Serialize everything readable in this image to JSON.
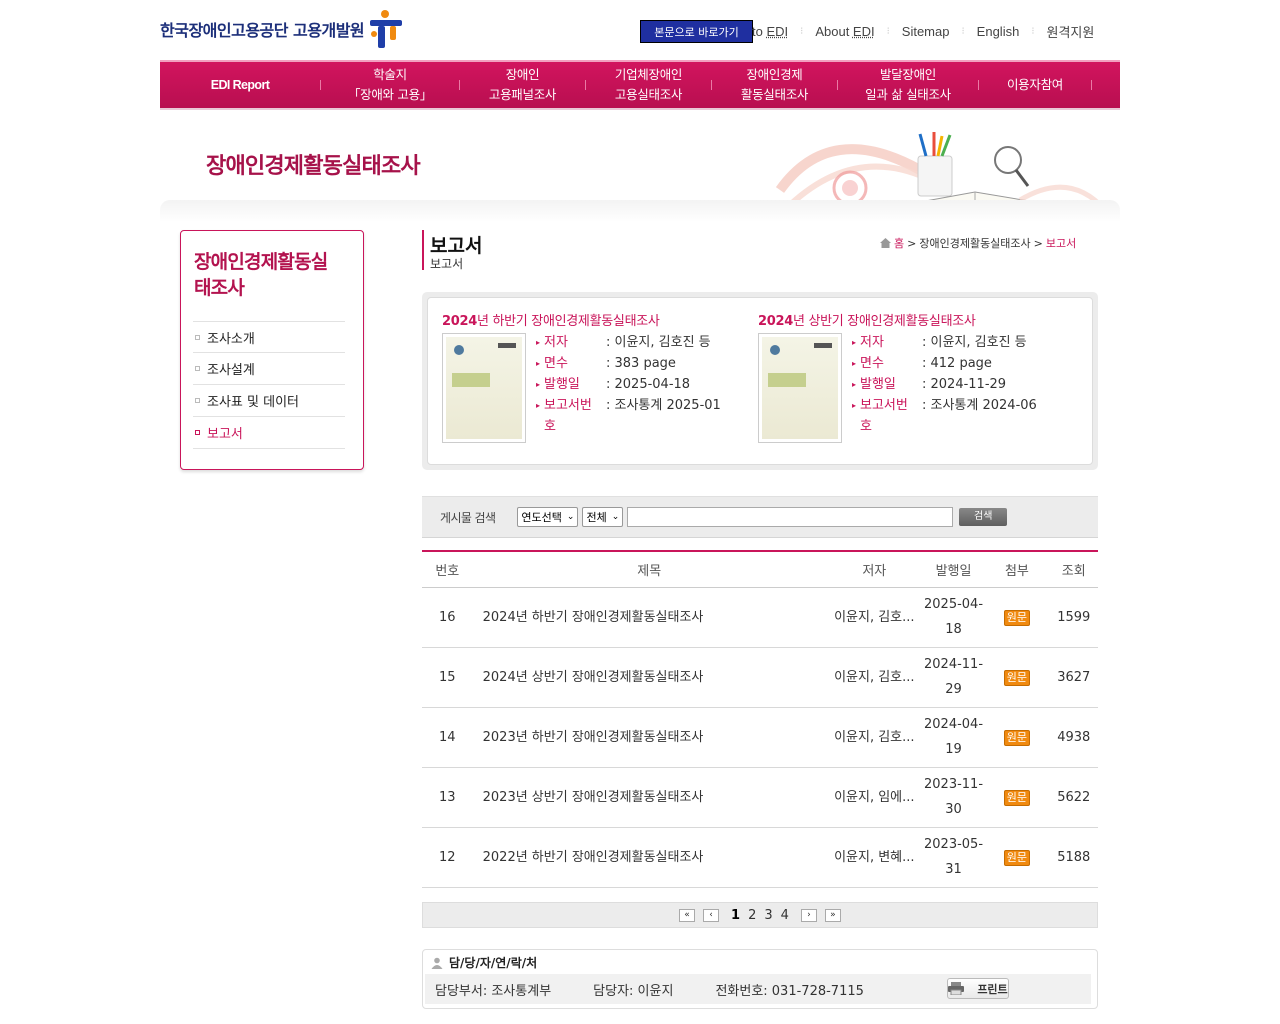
{
  "header": {
    "logo_text": "한국장애인고용공단 고용개발원",
    "skip_link": "본문으로 바로가기",
    "top_links": [
      {
        "text": "to ",
        "abbr": "EDI"
      },
      {
        "text": "About ",
        "abbr": "EDI"
      },
      {
        "text": "Sitemap",
        "abbr": ""
      },
      {
        "text": "English",
        "abbr": ""
      },
      {
        "text": "원격지원",
        "abbr": ""
      }
    ]
  },
  "gnb": {
    "items": [
      {
        "line1": "EDI Report",
        "line2": ""
      },
      {
        "line1": "학술지",
        "line2": "「장애와 고용」"
      },
      {
        "line1": "장애인",
        "line2": "고용패널조사"
      },
      {
        "line1": "기업체장애인",
        "line2": "고용실태조사"
      },
      {
        "line1": "장애인경제",
        "line2": "활동실태조사"
      },
      {
        "line1": "발달장애인",
        "line2": "일과 삶 실태조사"
      },
      {
        "line1": "이용자참여",
        "line2": ""
      }
    ]
  },
  "visual": {
    "title": "장애인경제활동실태조사"
  },
  "lnb": {
    "title": "장애인경제활동실태조사",
    "items": [
      {
        "label": "조사소개"
      },
      {
        "label": "조사설계"
      },
      {
        "label": "조사표 및 데이터"
      },
      {
        "label": "보고서"
      }
    ],
    "active": "보고서"
  },
  "content": {
    "title": "보고서",
    "subtitle": "보고서",
    "breadcrumb": {
      "home": "홈",
      "sep": ">",
      "level1": "장애인경제활동실태조사",
      "current": "보고서"
    }
  },
  "featured": [
    {
      "year": "2024",
      "title_rest": "년 하반기 장애인경제활동실태조사",
      "fields": [
        {
          "label": "저자",
          "value": ": 이윤지, 김호진 등"
        },
        {
          "label": "면수",
          "value": ": 383 page"
        },
        {
          "label": "발행일",
          "value": ": 2025-04-18"
        },
        {
          "label": "보고서번호",
          "value": ": 조사통계 2025-01"
        }
      ]
    },
    {
      "year": "2024",
      "title_rest": "년 상반기 장애인경제활동실태조사",
      "fields": [
        {
          "label": "저자",
          "value": ": 이윤지, 김호진 등"
        },
        {
          "label": "면수",
          "value": ": 412 page"
        },
        {
          "label": "발행일",
          "value": ": 2024-11-29"
        },
        {
          "label": "보고서번호",
          "value": ": 조사통계 2024-06"
        }
      ]
    }
  ],
  "search": {
    "label": "게시물 검색",
    "year_select": "연도선택",
    "field_select": "전체",
    "input_value": "",
    "button": "검색"
  },
  "table": {
    "headers": [
      "번호",
      "제목",
      "저자",
      "발행일",
      "첨부",
      "조회"
    ],
    "rows": [
      {
        "no": "16",
        "title": "2024년 하반기 장애인경제활동실태조사",
        "author": "이윤지, 김호...",
        "date1": "2025-04-",
        "date2": "18",
        "attach": "원문",
        "views": "1599"
      },
      {
        "no": "15",
        "title": "2024년 상반기 장애인경제활동실태조사",
        "author": "이윤지, 김호...",
        "date1": "2024-11-",
        "date2": "29",
        "attach": "원문",
        "views": "3627"
      },
      {
        "no": "14",
        "title": "2023년 하반기 장애인경제활동실태조사",
        "author": "이윤지, 김호...",
        "date1": "2024-04-",
        "date2": "19",
        "attach": "원문",
        "views": "4938"
      },
      {
        "no": "13",
        "title": "2023년 상반기 장애인경제활동실태조사",
        "author": "이윤지, 임에...",
        "date1": "2023-11-",
        "date2": "30",
        "attach": "원문",
        "views": "5622"
      },
      {
        "no": "12",
        "title": "2022년 하반기 장애인경제활동실태조사",
        "author": "이윤지, 변혜...",
        "date1": "2023-05-",
        "date2": "31",
        "attach": "원문",
        "views": "5188"
      }
    ]
  },
  "pager": {
    "first": "«",
    "prev": "‹",
    "pages": [
      "1",
      "2",
      "3",
      "4"
    ],
    "current": "1",
    "next": "›",
    "last": "»"
  },
  "contact": {
    "heading": "담/당/자/연/락/처",
    "department": "담당부서: 조사통계부",
    "person": "담당자: 이윤지",
    "phone": "전화번호: 031-728-7115",
    "print": "프린트"
  },
  "colors": {
    "brand": "#c9155a",
    "nav_dark": "#b80f50",
    "logo_blue": "#1c2f7a",
    "attach_orange": "#f08a10"
  }
}
